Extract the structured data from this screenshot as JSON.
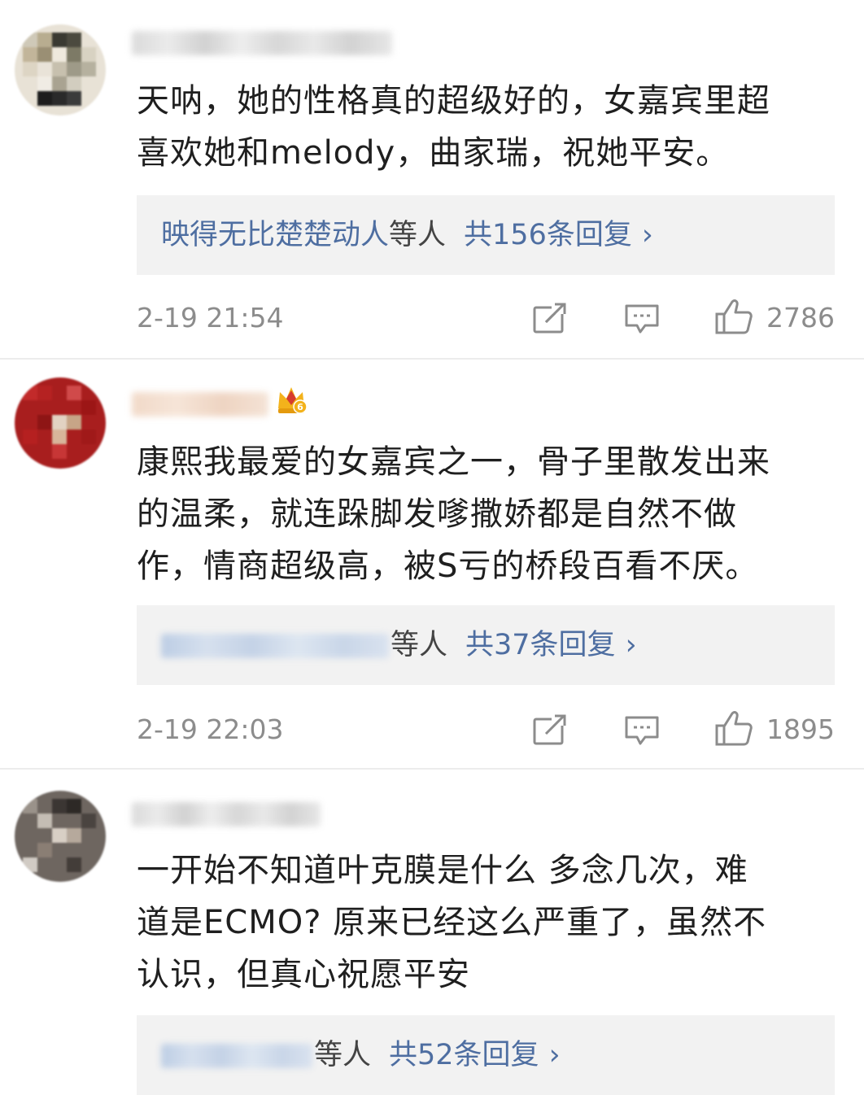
{
  "comments": [
    {
      "text": "天呐，她的性格真的超级好的，女嘉宾里超\n喜欢她和melody，曲家瑞，祝她平安。",
      "reply_users": "映得无比楚楚动人",
      "reply_etc": "等人",
      "reply_count": "共156条回复",
      "reply_chevron": "›",
      "timestamp": "2-19 21:54",
      "likes": "2786",
      "vip_badge": false
    },
    {
      "text": "康熙我最爱的女嘉宾之一，骨子里散发出来\n的温柔，就连跺脚发嗲撒娇都是自然不做\n作，情商超级高，被S亏的桥段百看不厌。",
      "reply_users": "",
      "reply_etc": "等人",
      "reply_count": "共37条回复",
      "reply_chevron": "›",
      "timestamp": "2-19 22:03",
      "likes": "1895",
      "vip_badge": true,
      "vip_level": "6"
    },
    {
      "text": "一开始不知道叶克膜是什么 多念几次，难\n道是ECMO? 原来已经这么严重了，虽然不\n认识，但真心祝愿平安",
      "reply_users": "",
      "reply_etc": "等人",
      "reply_count": "共52条回复",
      "reply_chevron": "›",
      "vip_badge": false
    }
  ],
  "icons": {
    "share": "share-icon",
    "comment": "comment-icon",
    "like": "thumbs-up-icon",
    "vip": "crown-vip-icon"
  },
  "colors": {
    "link_blue": "#4e6ea1",
    "meta_gray": "#8c8c8c",
    "reply_bg": "#f2f2f2",
    "crown_gold": "#f3b21b",
    "crown_red": "#d63b2f"
  }
}
